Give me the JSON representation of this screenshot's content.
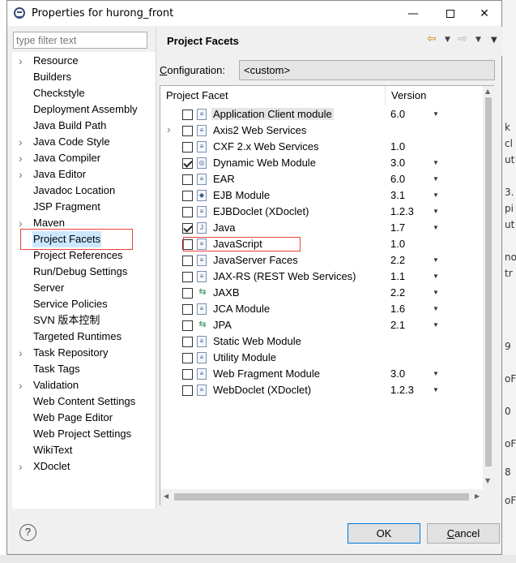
{
  "window": {
    "title": "Properties for hurong_front"
  },
  "filter": {
    "placeholder": "type filter text"
  },
  "nav": {
    "items": [
      {
        "label": "Resource",
        "expandable": true
      },
      {
        "label": "Builders",
        "expandable": false
      },
      {
        "label": "Checkstyle",
        "expandable": false
      },
      {
        "label": "Deployment Assembly",
        "expandable": false
      },
      {
        "label": "Java Build Path",
        "expandable": false
      },
      {
        "label": "Java Code Style",
        "expandable": true
      },
      {
        "label": "Java Compiler",
        "expandable": true
      },
      {
        "label": "Java Editor",
        "expandable": true
      },
      {
        "label": "Javadoc Location",
        "expandable": false
      },
      {
        "label": "JSP Fragment",
        "expandable": false
      },
      {
        "label": "Maven",
        "expandable": true
      },
      {
        "label": "Project Facets",
        "expandable": false,
        "selected": true
      },
      {
        "label": "Project References",
        "expandable": false
      },
      {
        "label": "Run/Debug Settings",
        "expandable": false
      },
      {
        "label": "Server",
        "expandable": false
      },
      {
        "label": "Service Policies",
        "expandable": false
      },
      {
        "label": "SVN 版本控制",
        "expandable": false
      },
      {
        "label": "Targeted Runtimes",
        "expandable": false
      },
      {
        "label": "Task Repository",
        "expandable": true
      },
      {
        "label": "Task Tags",
        "expandable": false
      },
      {
        "label": "Validation",
        "expandable": true
      },
      {
        "label": "Web Content Settings",
        "expandable": false
      },
      {
        "label": "Web Page Editor",
        "expandable": false
      },
      {
        "label": "Web Project Settings",
        "expandable": false
      },
      {
        "label": "WikiText",
        "expandable": false
      },
      {
        "label": "XDoclet",
        "expandable": true
      }
    ]
  },
  "page": {
    "title": "Project Facets",
    "configuration_label_pre": "",
    "configuration_label_u": "C",
    "configuration_label_post": "onfiguration:",
    "configuration_value": "<custom>"
  },
  "facets": {
    "col_facet": "Project Facet",
    "col_version": "Version",
    "rows": [
      {
        "label": "Application Client module",
        "checked": false,
        "version": "6.0",
        "dropdown": true,
        "icon": "module-icon",
        "highlight": true
      },
      {
        "label": "Axis2 Web Services",
        "checked": false,
        "version": "",
        "dropdown": false,
        "icon": "module-icon",
        "expandable": true
      },
      {
        "label": "CXF 2.x Web Services",
        "checked": false,
        "version": "1.0",
        "dropdown": false,
        "icon": "module-icon"
      },
      {
        "label": "Dynamic Web Module",
        "checked": true,
        "version": "3.0",
        "dropdown": true,
        "icon": "web-module-icon"
      },
      {
        "label": "EAR",
        "checked": false,
        "version": "6.0",
        "dropdown": true,
        "icon": "module-icon"
      },
      {
        "label": "EJB Module",
        "checked": false,
        "version": "3.1",
        "dropdown": true,
        "icon": "ejb-icon"
      },
      {
        "label": "EJBDoclet (XDoclet)",
        "checked": false,
        "version": "1.2.3",
        "dropdown": true,
        "icon": "module-icon"
      },
      {
        "label": "Java",
        "checked": true,
        "version": "1.7",
        "dropdown": true,
        "icon": "java-icon"
      },
      {
        "label": "JavaScript",
        "checked": false,
        "version": "1.0",
        "dropdown": false,
        "icon": "module-icon"
      },
      {
        "label": "JavaServer Faces",
        "checked": false,
        "version": "2.2",
        "dropdown": true,
        "icon": "module-icon"
      },
      {
        "label": "JAX-RS (REST Web Services)",
        "checked": false,
        "version": "1.1",
        "dropdown": true,
        "icon": "module-icon"
      },
      {
        "label": "JAXB",
        "checked": false,
        "version": "2.2",
        "dropdown": true,
        "icon": "arrows-icon"
      },
      {
        "label": "JCA Module",
        "checked": false,
        "version": "1.6",
        "dropdown": true,
        "icon": "module-icon"
      },
      {
        "label": "JPA",
        "checked": false,
        "version": "2.1",
        "dropdown": true,
        "icon": "arrows-icon"
      },
      {
        "label": "Static Web Module",
        "checked": false,
        "version": "",
        "dropdown": false,
        "icon": "module-icon"
      },
      {
        "label": "Utility Module",
        "checked": false,
        "version": "",
        "dropdown": false,
        "icon": "module-icon"
      },
      {
        "label": "Web Fragment Module",
        "checked": false,
        "version": "3.0",
        "dropdown": true,
        "icon": "module-icon"
      },
      {
        "label": "WebDoclet (XDoclet)",
        "checked": false,
        "version": "1.2.3",
        "dropdown": true,
        "icon": "module-icon"
      }
    ]
  },
  "footer": {
    "ok_label": "OK",
    "cancel_label_u": "C",
    "cancel_label_rest": "ancel"
  },
  "background": {
    "fragments": [
      "k",
      "cl",
      "ut",
      "3.",
      "pi",
      "ut",
      "no",
      "tr",
      "9",
      "oF",
      "0",
      "oF",
      "8",
      "oF"
    ]
  }
}
